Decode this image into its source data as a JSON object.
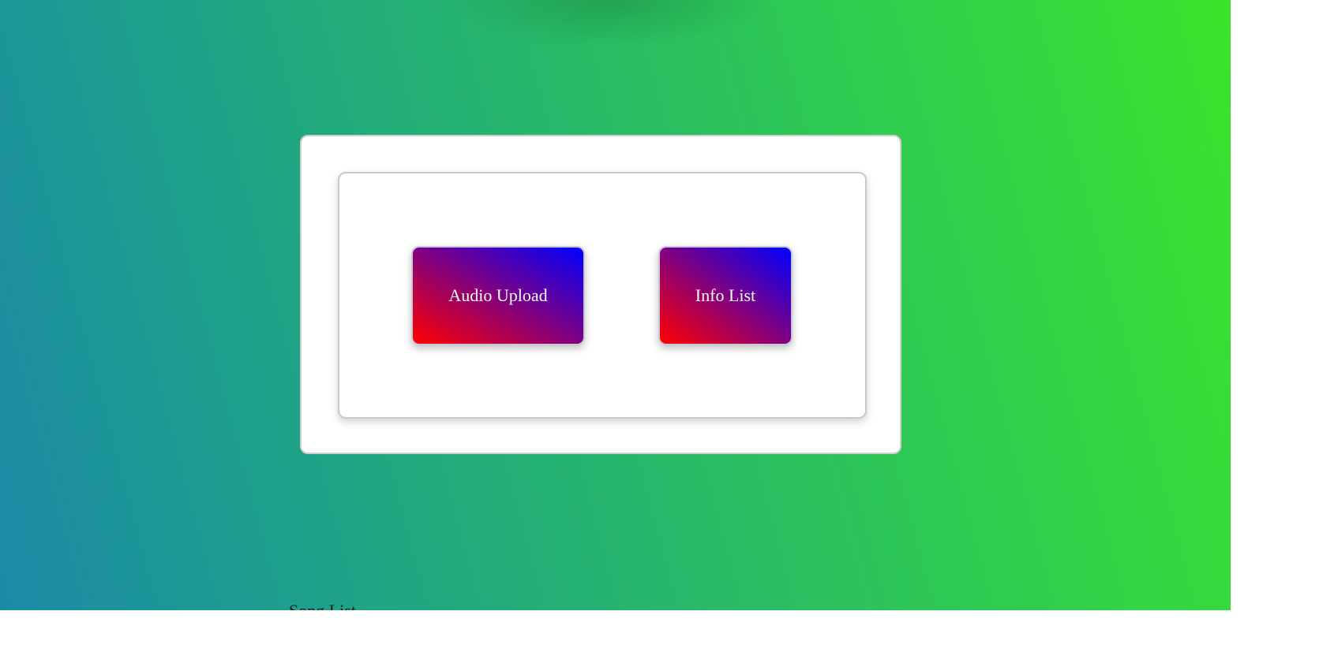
{
  "buttons": {
    "audio_upload": "Audio Upload",
    "info_list": "Info List"
  },
  "footer": {
    "song_list_heading": "Song List"
  },
  "colors": {
    "background_gradient": [
      "#1a8aa8",
      "#3ee81f"
    ],
    "button_gradient": [
      "#ff0000",
      "#800080",
      "#0000ff"
    ],
    "card_background": "#ffffff",
    "card_border": "#cfcfcf"
  }
}
